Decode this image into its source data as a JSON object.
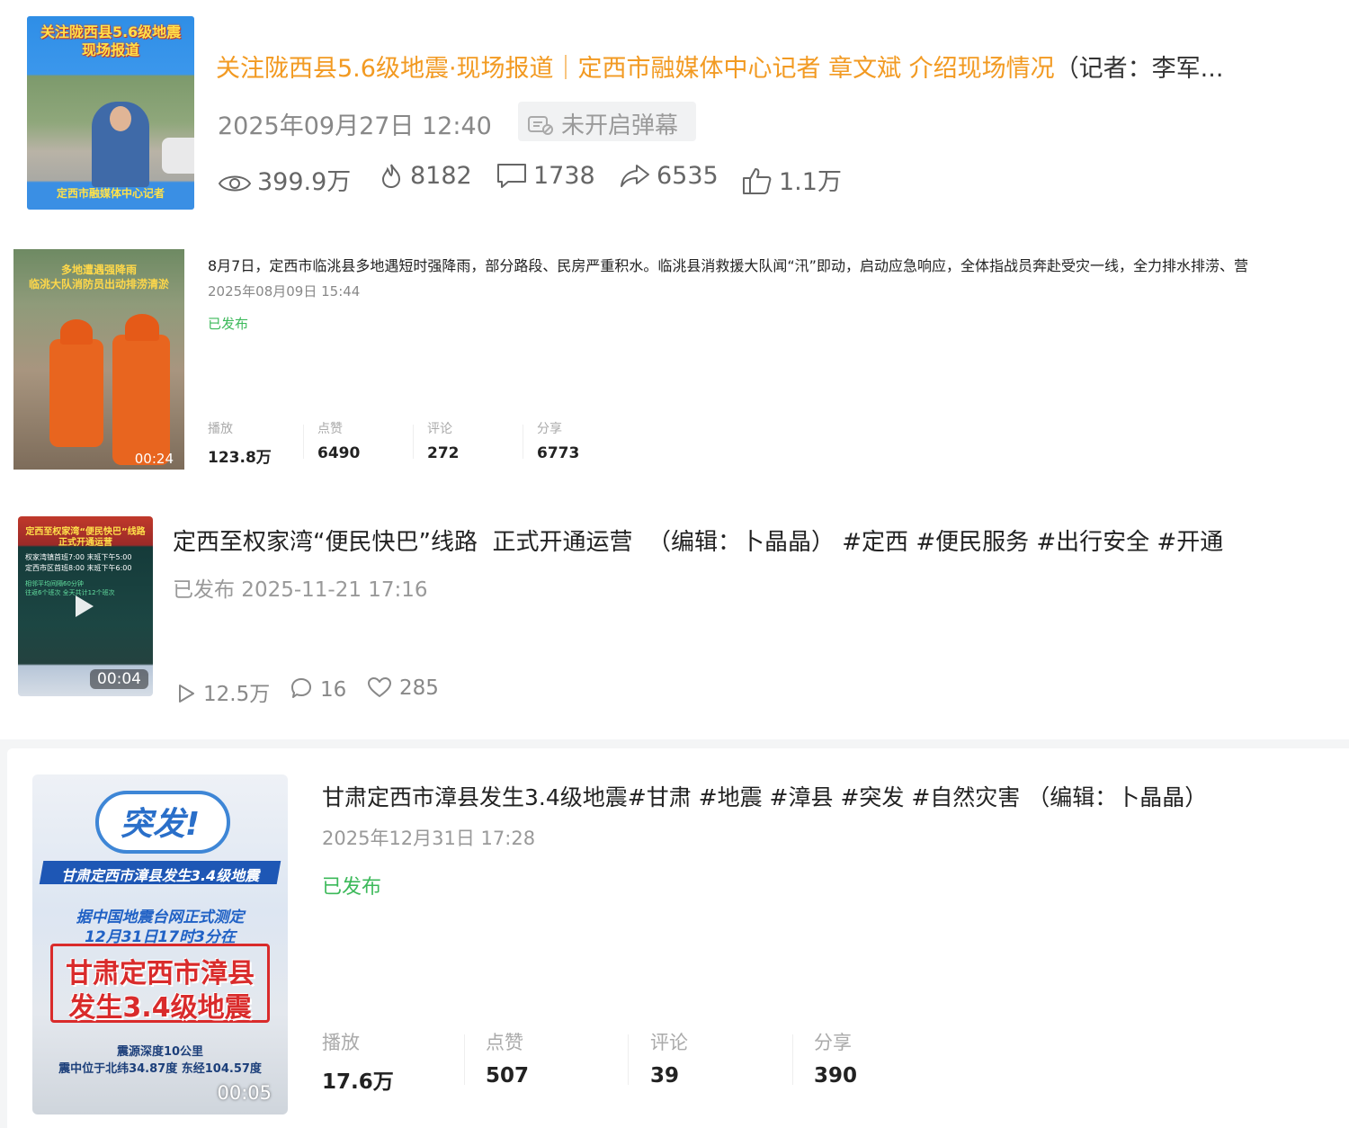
{
  "card1": {
    "thumb_title_line1": "关注陇西县5.6级地震",
    "thumb_title_line2": "现场报道",
    "thumb_caption": "定西市融媒体中心记者",
    "title_main": "关注陇西县5.6级地震·现场报道｜定西市融媒体中心记者 章文斌 介绍现场情况",
    "title_tail": "（记者：李军...",
    "date": "2025年09月27日 12:40",
    "danmu_label": "未开启弹幕",
    "views": "399.9万",
    "hot": "8182",
    "comments": "1738",
    "shares": "6535",
    "likes": "1.1万"
  },
  "card2": {
    "thumb_text_line1": "多地遭遇强降雨",
    "thumb_text_line2": "临洮大队消防员出动排涝清淤",
    "duration": "00:24",
    "description": "8月7日，定西市临洮县多地遇短时强降雨，部分路段、民房严重积水。临洮县消救援大队闻“汛”即动，启动应急响应，全体指战员奔赴受灾一线，全力排水排涝、营",
    "date": "2025年08月09日 15:44",
    "status": "已发布",
    "metrics": [
      {
        "label": "播放",
        "value": "123.8万"
      },
      {
        "label": "点赞",
        "value": "6490"
      },
      {
        "label": "评论",
        "value": "272"
      },
      {
        "label": "分享",
        "value": "6773"
      }
    ]
  },
  "card3": {
    "thumb_title_line1": "定西至权家湾“便民快巴”线路",
    "thumb_title_line2": "正式开通运营",
    "thumb_line1": "权家湾镇首班7:00 末班下午5:00",
    "thumb_line2": "定西市区首班8:00 末班下午6:00",
    "thumb_line3": "相邻平均间隔60分钟",
    "thumb_line4": "往返6个班次 全天共计12个班次",
    "duration": "00:04",
    "title": "定西至权家湾“便民快巴”线路  正式开通运营  （编辑：卜晶晶） #定西 #便民服务 #出行安全 #开通",
    "meta": "已发布 2025-11-21 17:16",
    "plays": "12.5万",
    "comments": "16",
    "likes": "285"
  },
  "card4": {
    "thumb_burst": "突发!",
    "thumb_band": "甘肃定西市漳县发生3.4级地震",
    "thumb_blue1": "据中国地震台网正式测定",
    "thumb_blue2": "12月31日17时3分在",
    "thumb_red1": "甘肃定西市漳县",
    "thumb_red2": "发生3.4级地震",
    "thumb_small1": "震源深度10公里",
    "thumb_small2": "震中位于北纬34.87度  东经104.57度",
    "duration": "00:05",
    "title": "甘肃定西市漳县发生3.4级地震#甘肃 #地震 #漳县 #突发 #自然灾害 （编辑：卜晶晶）",
    "date": "2025年12月31日 17:28",
    "status": "已发布",
    "metrics": [
      {
        "label": "播放",
        "value": "17.6万"
      },
      {
        "label": "点赞",
        "value": "507"
      },
      {
        "label": "评论",
        "value": "39"
      },
      {
        "label": "分享",
        "value": "390"
      }
    ]
  },
  "colors": {
    "accent_orange": "#f29a22",
    "published_green": "#3cb95a",
    "muted_gray": "#999999"
  }
}
